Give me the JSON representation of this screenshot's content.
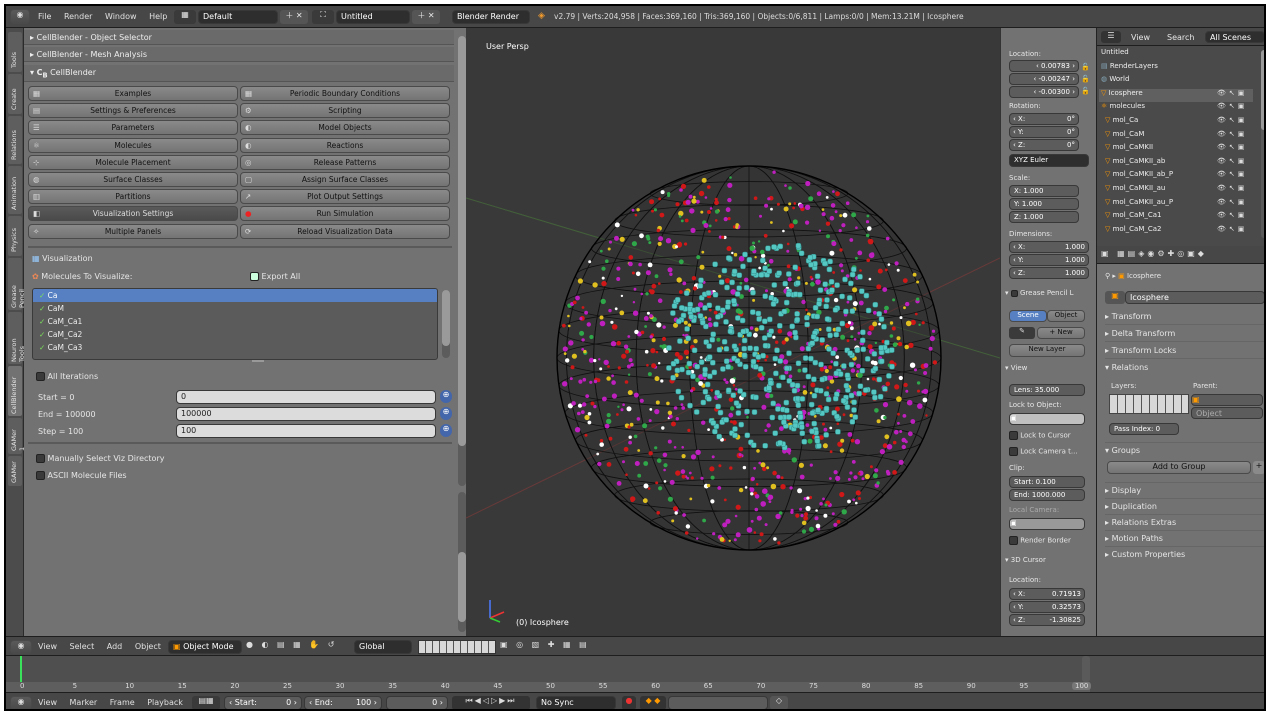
{
  "header": {
    "menus": [
      "File",
      "Render",
      "Window",
      "Help"
    ],
    "layout": "Default",
    "scene": "Untitled",
    "engine": "Blender Render",
    "stats": "v2.79 | Verts:204,958 | Faces:369,160 | Tris:369,160 | Objects:0/6,811 | Lamps:0/0 | Mem:13.21M | Icosphere"
  },
  "toolshelf_tabs": [
    "Tools",
    "Create",
    "Relations",
    "Animation",
    "Physics",
    "Grease Pencil",
    "Neuron Tools",
    "CellBlender",
    "GAMer 1",
    "GAMer"
  ],
  "panels": {
    "object_selector": "CellBlender - Object Selector",
    "mesh_analysis": "CellBlender - Mesh Analysis",
    "cellblender": "CellBlender"
  },
  "cb_buttons": [
    [
      "Examples",
      "Periodic Boundary Conditions"
    ],
    [
      "Settings & Preferences",
      "Scripting"
    ],
    [
      "Parameters",
      "Model Objects"
    ],
    [
      "Molecules",
      "Reactions"
    ],
    [
      "Molecule Placement",
      "Release Patterns"
    ],
    [
      "Surface Classes",
      "Assign Surface Classes"
    ],
    [
      "Partitions",
      "Plot Output Settings"
    ],
    [
      "Visualization Settings",
      "Run Simulation"
    ],
    [
      "Multiple Panels",
      "Reload Visualization Data"
    ]
  ],
  "visualization": {
    "title": "Visualization",
    "molecules_label": "Molecules To Visualize:",
    "export_all": "Export All",
    "molecules": [
      "Ca",
      "CaM",
      "CaM_Ca1",
      "CaM_Ca2",
      "CaM_Ca3"
    ],
    "all_iterations": "All Iterations",
    "start_label": "Start = 0",
    "start_value": "0",
    "end_label": "End = 100000",
    "end_value": "100000",
    "step_label": "Step = 100",
    "step_value": "100",
    "manual_dir": "Manually Select Viz Directory",
    "ascii": "ASCII Molecule Files"
  },
  "viewport": {
    "label": "User Persp",
    "object_label": "(0) Icosphere"
  },
  "properties_n": {
    "location_label": "Location:",
    "location": [
      "0.00783",
      "-0.00247",
      "-0.00300"
    ],
    "rotation_label": "Rotation:",
    "rotation": [
      "X:",
      "0°",
      "Y:",
      "0°",
      "Z:",
      "0°"
    ],
    "rot_mode": "XYZ Euler",
    "scale_label": "Scale:",
    "scale": [
      "X: 1.000",
      "Y: 1.000",
      "Z: 1.000"
    ],
    "dimensions_label": "Dimensions:",
    "dimensions": [
      "X:",
      "1.000",
      "Y:",
      "1.000",
      "Z:",
      "1.000"
    ],
    "grease_pencil": "Grease Pencil L",
    "gp_scene": "Scene",
    "gp_object": "Object",
    "gp_new": "New",
    "gp_new_layer": "New Layer",
    "view_label": "View",
    "lens": "Lens:  35.000",
    "lock_obj": "Lock to Object:",
    "lock_cursor": "Lock to Cursor",
    "lock_camera": "Lock Camera t...",
    "clip": "Clip:",
    "clip_start": "Start:  0.100",
    "clip_end": "End: 1000.000",
    "local_camera": "Local Camera:",
    "render_border": "Render Border",
    "cursor_label": "3D Cursor",
    "cursor_location": "Location:",
    "cursor": [
      "X:",
      "0.71913",
      "Y:",
      "0.32573",
      "Z:",
      "-1.30825"
    ]
  },
  "outliner": {
    "tabs": [
      "View",
      "Search",
      "All Scenes"
    ],
    "rows": [
      "Untitled",
      "RenderLayers",
      "World",
      "Icosphere",
      "molecules",
      "mol_Ca",
      "mol_CaM",
      "mol_CaMKII",
      "mol_CaMKII_ab",
      "mol_CaMKII_ab_P",
      "mol_CaMKII_au",
      "mol_CaMKII_au_P",
      "mol_CaM_Ca1",
      "mol_CaM_Ca2"
    ]
  },
  "obj_props": {
    "breadcrumb": "Icosphere",
    "name": "Icosphere",
    "sections": [
      "Transform",
      "Delta Transform",
      "Transform Locks",
      "Relations"
    ],
    "layers": "Layers:",
    "parent": "Parent:",
    "parent_type": "Object",
    "pass_index": "Pass Index:   0",
    "groups": "Groups",
    "add_group": "Add to Group",
    "more_sections": [
      "Display",
      "Duplication",
      "Relations Extras",
      "Motion Paths",
      "Custom Properties"
    ]
  },
  "view3d_header": {
    "menus": [
      "View",
      "Select",
      "Add",
      "Object"
    ],
    "mode": "Object Mode",
    "orientation": "Global"
  },
  "timeline": {
    "ticks": [
      "0",
      "5",
      "10",
      "15",
      "20",
      "25",
      "30",
      "35",
      "40",
      "45",
      "50",
      "55",
      "60",
      "65",
      "70",
      "75",
      "80",
      "85",
      "90",
      "95",
      "100"
    ],
    "menus": [
      "View",
      "Marker",
      "Frame",
      "Playback"
    ],
    "start": "Start:",
    "start_val": "0",
    "end": "End:",
    "end_val": "100",
    "current": "0",
    "sync": "No Sync"
  },
  "colors": {
    "accent": "#5680c2",
    "viewport_bg": "#393939",
    "cyan": "#56c8c4",
    "magenta": "#c01fc0",
    "red": "#d01818",
    "frame_line": "#39e25a"
  }
}
